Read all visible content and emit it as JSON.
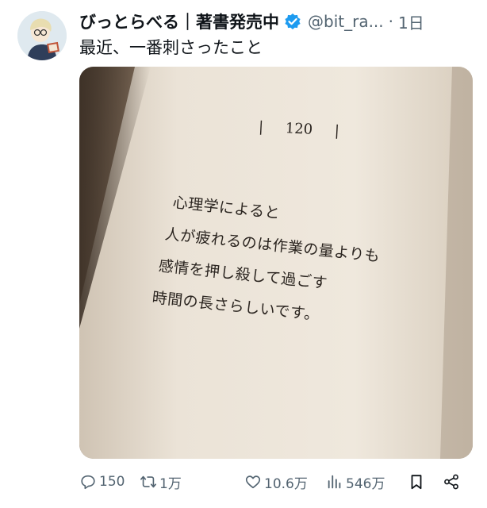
{
  "post": {
    "display_name": "びっとらべる｜著書発売中",
    "handle": "@bit_ra...",
    "separator": "·",
    "time": "1日",
    "text": "最近、一番刺さったこと"
  },
  "image": {
    "page_number_marks": [
      "|",
      "|"
    ],
    "page_number": "120",
    "lines": [
      "心理学によると",
      "人が疲れるのは作業の量よりも",
      "感情を押し殺して過ごす",
      "時間の長さらしいです。"
    ]
  },
  "actions": {
    "replies": "150",
    "reposts": "1万",
    "likes": "10.6万",
    "views": "546万"
  },
  "colors": {
    "text": "#0f1419",
    "secondary": "#536471",
    "verified": "#1d9bf0"
  },
  "icons": [
    "avatar",
    "verified-badge-icon",
    "reply-icon",
    "repost-icon",
    "like-icon",
    "views-icon",
    "bookmark-icon",
    "share-icon"
  ]
}
